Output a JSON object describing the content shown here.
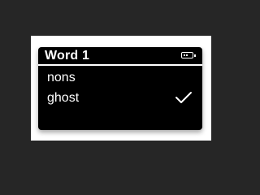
{
  "screen": {
    "title": "Word 1",
    "battery_icon": "battery-icon",
    "items": [
      {
        "label": "nons",
        "selected": false
      },
      {
        "label": "ghost",
        "selected": true
      }
    ],
    "check_icon": "checkmark-icon"
  },
  "colors": {
    "background": "#262626",
    "frame": "#ffffff",
    "device": "#000000",
    "text": "#ffffff"
  }
}
